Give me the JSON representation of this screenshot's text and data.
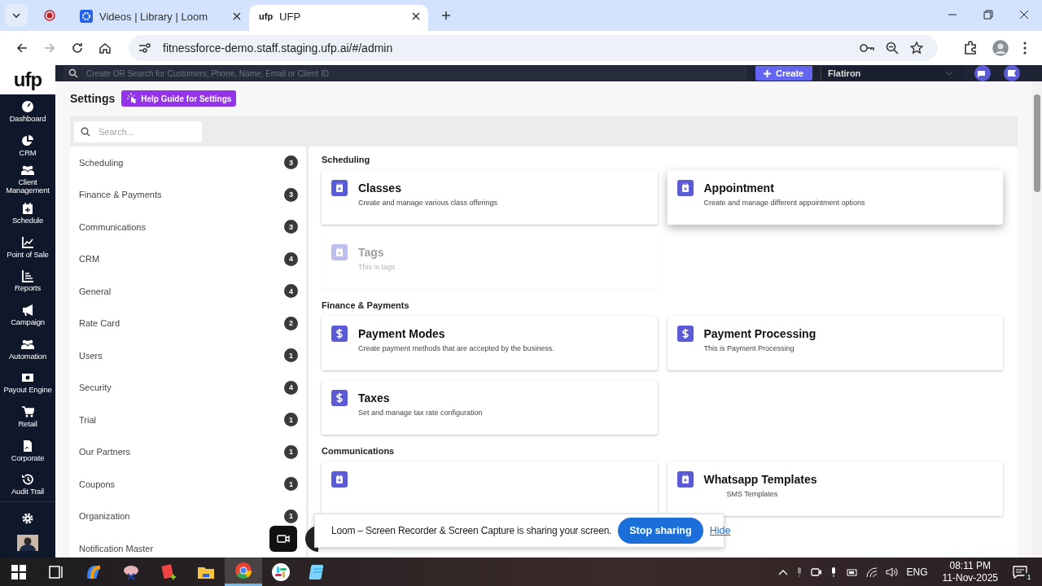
{
  "browser": {
    "tabs": [
      {
        "title": "Videos | Library | Loom",
        "kind": "gear",
        "selected": false
      },
      {
        "title": "UFP",
        "favicon_text": "ufp",
        "selected": true
      }
    ],
    "url": "fitnessforce-demo.staff.staging.ufp.ai/#/admin"
  },
  "topbar": {
    "search_placeholder": "Create OR Search for Customers, Phone, Name, Email or Client ID",
    "create_label": "Create",
    "location": "Flatiron"
  },
  "nav": {
    "logo": "ufp",
    "items": [
      {
        "label": "Dashboard",
        "kind": "gauge"
      },
      {
        "label": "CRM",
        "kind": "pie"
      },
      {
        "label": "Client Management",
        "kind": "people"
      },
      {
        "label": "Schedule",
        "kind": "calendar"
      },
      {
        "label": "Point of Sale",
        "kind": "chart"
      },
      {
        "label": "Reports",
        "kind": "bars"
      },
      {
        "label": "Campaign",
        "kind": "megaphone"
      },
      {
        "label": "Automation",
        "kind": "people"
      },
      {
        "label": "Payout Engine",
        "kind": "cash"
      },
      {
        "label": "Retail",
        "kind": "cart"
      },
      {
        "label": "Corporate",
        "kind": "document"
      },
      {
        "label": "Audit Trail",
        "kind": "history"
      }
    ]
  },
  "settings": {
    "title": "Settings",
    "help_button": "Help Guide for Settings",
    "search_placeholder": "Search...",
    "categories": [
      {
        "label": "Scheduling",
        "count": "3"
      },
      {
        "label": "Finance & Payments",
        "count": "3"
      },
      {
        "label": "Communications",
        "count": "3"
      },
      {
        "label": "CRM",
        "count": "4"
      },
      {
        "label": "General",
        "count": "4"
      },
      {
        "label": "Rate Card",
        "count": "2"
      },
      {
        "label": "Users",
        "count": "1"
      },
      {
        "label": "Security",
        "count": "4"
      },
      {
        "label": "Trial",
        "count": "1"
      },
      {
        "label": "Our Partners",
        "count": "1"
      },
      {
        "label": "Coupons",
        "count": "1"
      },
      {
        "label": "Organization",
        "count": "1"
      },
      {
        "label": "Notification Master"
      }
    ],
    "sections": [
      {
        "title": "Scheduling",
        "cards": [
          {
            "title": "Classes",
            "description": "Create and manage various class offerings",
            "kind": "calendar",
            "disabled": false,
            "hovered": false
          },
          {
            "title": "Appointment",
            "description": "Create and manage different appointment options",
            "kind": "calendar",
            "disabled": false,
            "hovered": true
          },
          {
            "title": "Tags",
            "description": "This is tags",
            "kind": "calendar",
            "disabled": true,
            "hovered": false
          }
        ]
      },
      {
        "title": "Finance & Payments",
        "cards": [
          {
            "title": "Payment Modes",
            "description": "Create payment methods that are accepted by the business.",
            "kind": "dollar",
            "disabled": false,
            "hovered": false
          },
          {
            "title": "Payment Processing",
            "description": "This is Payment Processing",
            "kind": "dollar",
            "disabled": false,
            "hovered": false
          },
          {
            "title": "Taxes",
            "description": "Set and manage tax rate configuration",
            "kind": "dollar",
            "disabled": false,
            "hovered": false
          }
        ]
      },
      {
        "title": "Communications",
        "cards": [
          {
            "kind": "calendar",
            "disabled": false,
            "hovered": false
          },
          {
            "title": "Whatsapp Templates",
            "description": "SMS Templates",
            "kind": "calendar",
            "disabled": false,
            "hovered": false
          }
        ]
      }
    ]
  },
  "loom": {
    "message": "Loom – Screen Recorder & Screen Capture is sharing your screen.",
    "stop_button": "Stop sharing",
    "hide_link": "Hide"
  },
  "taskbar": {
    "apps": [
      {
        "kind": "start",
        "selected": false
      },
      {
        "kind": "taskview",
        "selected": false
      },
      {
        "kind": "copilot",
        "selected": false
      },
      {
        "kind": "snip",
        "selected": false
      },
      {
        "kind": "notes",
        "selected": false
      },
      {
        "kind": "folder",
        "selected": false
      },
      {
        "kind": "chrome",
        "selected": true
      },
      {
        "kind": "slack",
        "selected": false
      },
      {
        "kind": "notepad",
        "selected": false
      }
    ],
    "language": "ENG",
    "time": "08:11 PM",
    "date": "11-Nov-2025",
    "notifications": "1"
  }
}
